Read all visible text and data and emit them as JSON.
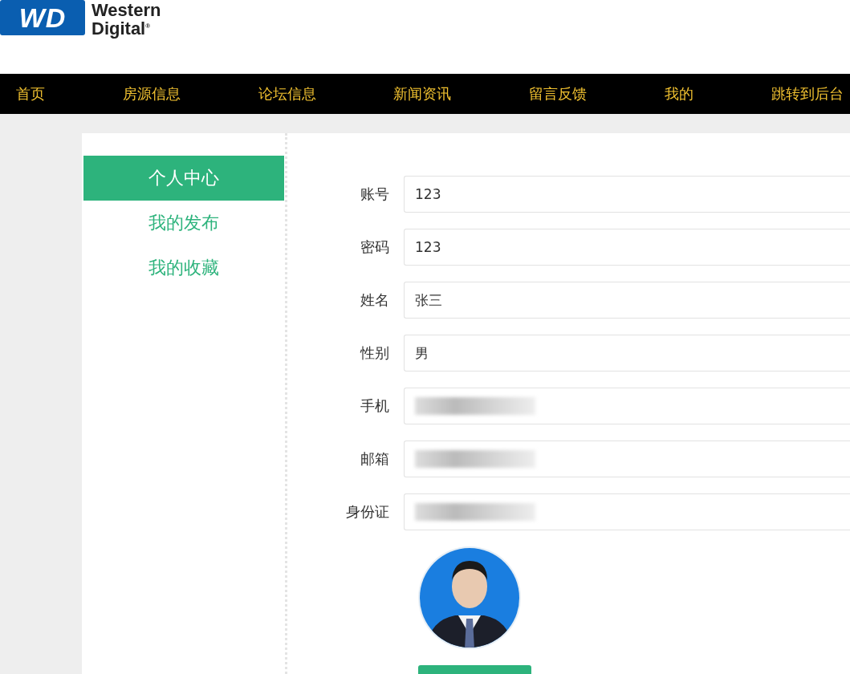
{
  "logo": {
    "badge": "WD",
    "line1": "Western",
    "line2": "Digital",
    "mark": "®"
  },
  "nav": [
    {
      "label": "首页"
    },
    {
      "label": "房源信息"
    },
    {
      "label": "论坛信息"
    },
    {
      "label": "新闻资讯"
    },
    {
      "label": "留言反馈"
    },
    {
      "label": "我的"
    },
    {
      "label": "跳转到后台"
    }
  ],
  "sidebar": {
    "items": [
      {
        "label": "个人中心",
        "selected": true
      },
      {
        "label": "我的发布",
        "selected": false
      },
      {
        "label": "我的收藏",
        "selected": false
      }
    ]
  },
  "form": {
    "fields": [
      {
        "label": "账号",
        "value": "123",
        "redacted": false
      },
      {
        "label": "密码",
        "value": "123",
        "redacted": false
      },
      {
        "label": "姓名",
        "value": "张三",
        "redacted": false
      },
      {
        "label": "性别",
        "value": "男",
        "redacted": false
      },
      {
        "label": "手机",
        "redacted": true
      },
      {
        "label": "邮箱",
        "redacted": true
      },
      {
        "label": "身份证",
        "redacted": true
      }
    ]
  }
}
